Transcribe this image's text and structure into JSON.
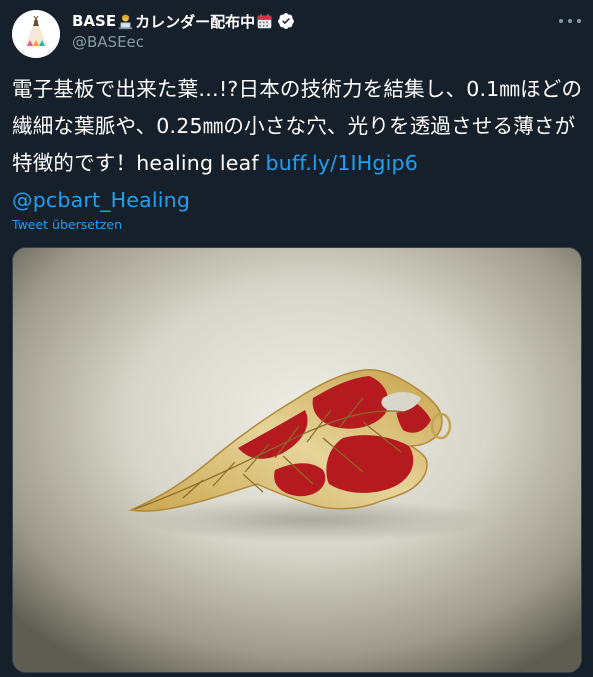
{
  "tweet": {
    "author": {
      "name_prefix": "BASE",
      "name_middle": "カレンダー配布中",
      "name_emoji_1": "technologist-emoji",
      "name_emoji_2": "calendar-emoji",
      "handle": "@BASEec",
      "verified": true,
      "avatar_icon": "teepee-logo-icon"
    },
    "text_main": "電子基板で出来た葉…!?日本の技術力を結集し、0.1㎜ほどの繊細な葉脈や、0.25㎜の小さな穴、光りを透過させる薄さが特徴的です！healing leaf ",
    "link_1": "buff.ly/1IHgip6",
    "mention": "@pcbart_Healing",
    "translate_label": "Tweet übersetzen",
    "media": {
      "type": "photo",
      "subject": "pcb-healing-leaf"
    }
  },
  "colors": {
    "background": "#15202b",
    "text": "#ffffff",
    "secondary": "#8899a6",
    "link": "#1da1f2",
    "border": "#38444d",
    "leaf_red": "#b51a1f",
    "leaf_gold": "#d9c58a"
  }
}
